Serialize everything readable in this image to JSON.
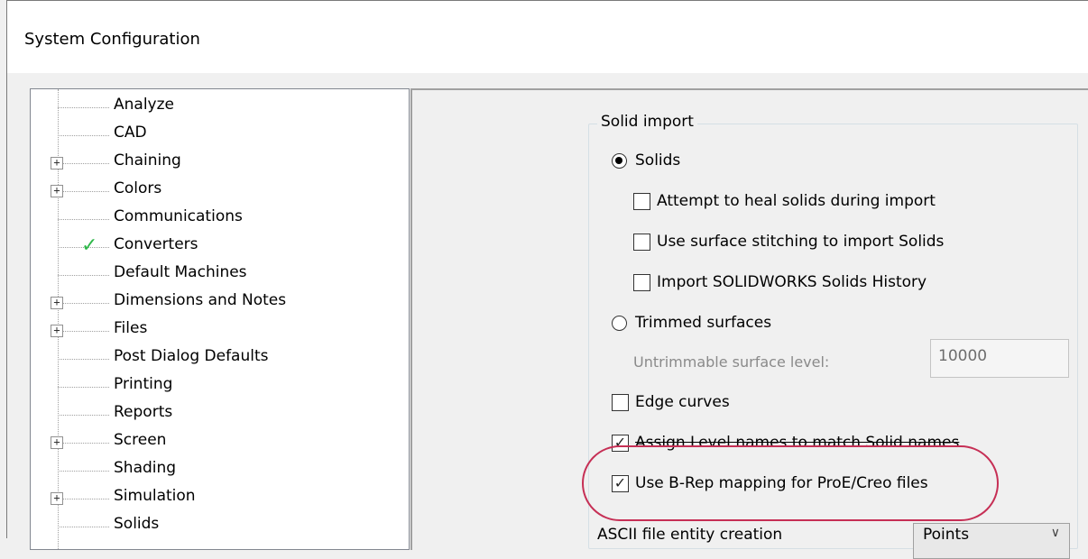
{
  "window": {
    "title": "System Configuration"
  },
  "tree": {
    "items": [
      {
        "label": "Analyze",
        "expandable": false,
        "checked": false
      },
      {
        "label": "CAD",
        "expandable": false,
        "checked": false
      },
      {
        "label": "Chaining",
        "expandable": true,
        "checked": false
      },
      {
        "label": "Colors",
        "expandable": true,
        "checked": false
      },
      {
        "label": "Communications",
        "expandable": false,
        "checked": false
      },
      {
        "label": "Converters",
        "expandable": false,
        "checked": true
      },
      {
        "label": "Default Machines",
        "expandable": false,
        "checked": false
      },
      {
        "label": "Dimensions and Notes",
        "expandable": true,
        "checked": false
      },
      {
        "label": "Files",
        "expandable": true,
        "checked": false
      },
      {
        "label": "Post Dialog Defaults",
        "expandable": false,
        "checked": false
      },
      {
        "label": "Printing",
        "expandable": false,
        "checked": false
      },
      {
        "label": "Reports",
        "expandable": false,
        "checked": false
      },
      {
        "label": "Screen",
        "expandable": true,
        "checked": false
      },
      {
        "label": "Shading",
        "expandable": false,
        "checked": false
      },
      {
        "label": "Simulation",
        "expandable": true,
        "checked": false
      },
      {
        "label": "Solids",
        "expandable": false,
        "checked": false
      }
    ],
    "expander_glyph": "+",
    "check_glyph": "✓"
  },
  "solid_import": {
    "legend": "Solid import",
    "solids_radio": {
      "label": "Solids",
      "selected": true
    },
    "heal_checkbox": {
      "label": "Attempt to heal solids during import",
      "checked": false
    },
    "stitching_checkbox": {
      "label": "Use surface stitching to import Solids",
      "checked": false
    },
    "history_checkbox": {
      "label": "Import SOLIDWORKS Solids History",
      "checked": false
    },
    "trimmed_radio": {
      "label": "Trimmed surfaces",
      "selected": false
    },
    "untrimmable": {
      "label": "Untrimmable surface level:",
      "value": "10000"
    },
    "edge_curves_checkbox": {
      "label": "Edge curves",
      "checked": false
    },
    "assign_level_checkbox": {
      "label": "Assign Level names to match Solid names",
      "checked": true
    },
    "brep_checkbox": {
      "label": "Use B-Rep mapping for ProE/Creo files",
      "checked": true
    },
    "check_mark": "✓"
  },
  "ascii": {
    "label": "ASCII file entity creation",
    "value": "Points",
    "arrow": "∨"
  },
  "colors": {
    "highlight": "#c62f55",
    "check_green": "#2fb84a"
  }
}
